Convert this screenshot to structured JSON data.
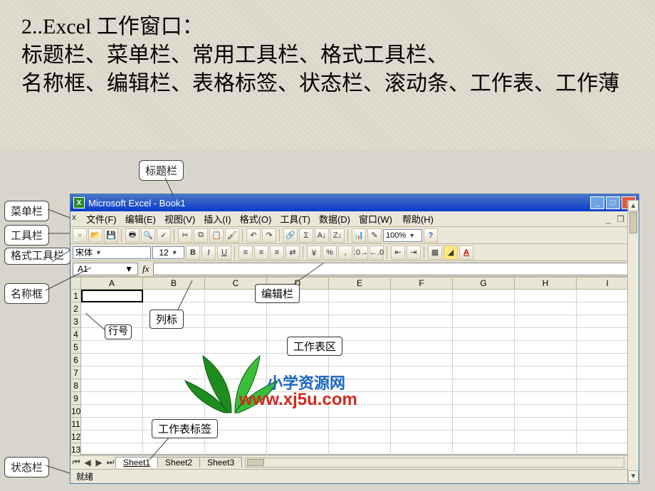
{
  "intro": {
    "line1": "2..Excel 工作窗口：",
    "line2": "标题栏、菜单栏、常用工具栏、格式工具栏、",
    "line3": "名称框、编辑栏、表格标签、状态栏、滚动条、工作表、工作薄"
  },
  "callouts": {
    "title": "标题栏",
    "menubar": "菜单栏",
    "toolbar": "工具栏",
    "formatbar": "格式工具栏",
    "namebox": "名称框",
    "statusbar": "状态栏",
    "col_header": "列标",
    "row_header": "行号",
    "formula_bar": "编辑栏",
    "sheet_area": "工作表区",
    "sheet_tabs": "工作表标签"
  },
  "titlebar": {
    "text": "Microsoft Excel - Book1",
    "icon_letter": "X"
  },
  "menu": {
    "file": "文件(F)",
    "edit": "编辑(E)",
    "view": "视图(V)",
    "insert": "插入(I)",
    "format": "格式(O)",
    "tools": "工具(T)",
    "data": "数据(D)",
    "window": "窗口(W)",
    "help": "帮助(H)"
  },
  "standard_toolbar": {
    "zoom": "100%"
  },
  "format_toolbar": {
    "font_name": "宋体",
    "font_size": "12",
    "bold": "B",
    "italic": "I",
    "underline": "U",
    "currency": "￥",
    "percent": "%",
    "comma": ","
  },
  "namebox": {
    "value": "A1",
    "fx": "fx"
  },
  "columns": [
    "A",
    "B",
    "C",
    "D",
    "E",
    "F",
    "G",
    "H",
    "I"
  ],
  "rows": [
    "1",
    "2",
    "3",
    "4",
    "5",
    "6",
    "7",
    "8",
    "9",
    "10",
    "11",
    "12",
    "13"
  ],
  "sheets": {
    "items": [
      "Sheet1",
      "Sheet2",
      "Sheet3"
    ],
    "active": 0
  },
  "statusbar": {
    "text": "就绪"
  },
  "watermark": {
    "line1": "小学资源网",
    "line2": "www.xj5u.com",
    "colors": {
      "line1": "#1b66c2",
      "line2": "#d02a1f"
    }
  }
}
